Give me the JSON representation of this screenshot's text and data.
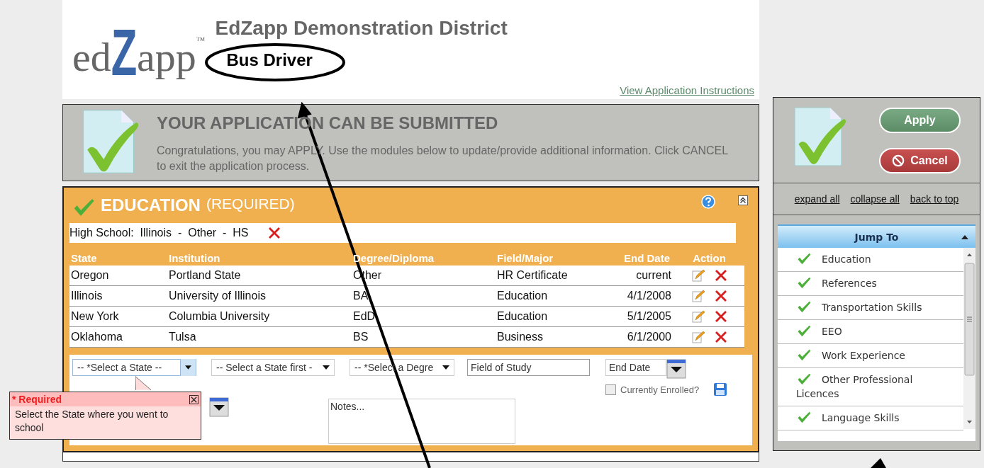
{
  "header": {
    "logo": {
      "left": "ed",
      "mark": "Z",
      "right": "app",
      "tm": "™"
    },
    "district": "EdZapp Demonstration District",
    "job_title": "Bus Driver",
    "instructions_link": "View Application Instructions"
  },
  "banner": {
    "title": "YOUR APPLICATION CAN BE SUBMITTED",
    "message": "Congratulations, you may APPLY. Use the modules below to update/provide additional information. Click CANCEL to exit the application process."
  },
  "section": {
    "title": "EDUCATION",
    "qualifier": "(REQUIRED)",
    "complete": true,
    "high_school": "High School:  Illinois  -  Other  -  HS",
    "table": {
      "columns": [
        "State",
        "Institution",
        "Degree/Diploma",
        "Field/Major",
        "End Date",
        "Action"
      ],
      "rows": [
        {
          "state": "Oregon",
          "institution": "Portland State",
          "degree": "Other",
          "field": "HR Certificate",
          "end_date": "current"
        },
        {
          "state": "Illinois",
          "institution": "University of Illinois",
          "degree": "BA",
          "field": "Education",
          "end_date": "4/1/2008"
        },
        {
          "state": "New York",
          "institution": "Columbia University",
          "degree": "EdD",
          "field": "Education",
          "end_date": "5/1/2005"
        },
        {
          "state": "Oklahoma",
          "institution": "Tulsa",
          "degree": "BS",
          "field": "Business",
          "end_date": "6/1/2000"
        }
      ]
    },
    "form": {
      "state_select": "-- *Select a State --",
      "institution_select": "-- Select a State first -",
      "degree_select": "-- *Select a Degre",
      "field_of_study": {
        "placeholder": "Field of Study"
      },
      "end_date": {
        "placeholder": "End Date"
      },
      "currently_enrolled": {
        "label": "Currently Enrolled?",
        "checked": false
      },
      "notes": {
        "placeholder": "Notes..."
      }
    },
    "tooltip": {
      "title": "* Required",
      "message": "Select the State where you went to school"
    }
  },
  "sidebar": {
    "buttons": [
      {
        "label": "Apply",
        "kind": "apply"
      },
      {
        "label": "Cancel",
        "kind": "cancel"
      }
    ],
    "links": [
      "expand all",
      "collapse all",
      "back to top"
    ],
    "jump_to": {
      "title": "Jump To",
      "items": [
        {
          "label": "Education",
          "checked": true
        },
        {
          "label": "References",
          "checked": true
        },
        {
          "label": "Transportation Skills",
          "checked": true
        },
        {
          "label": "EEO",
          "checked": true
        },
        {
          "label": "Work Experience",
          "checked": true
        },
        {
          "label": "Other Professional Licences",
          "checked": true
        },
        {
          "label": "Language Skills",
          "checked": true
        }
      ]
    }
  }
}
